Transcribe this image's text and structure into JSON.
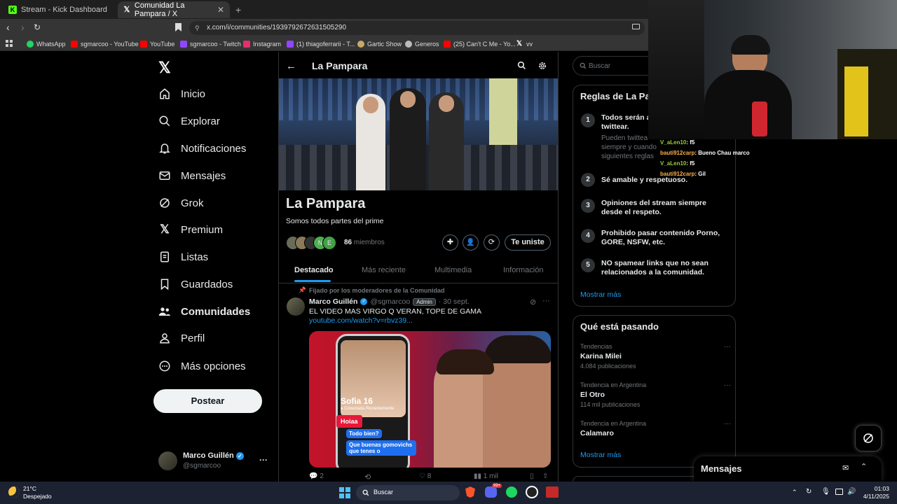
{
  "browser": {
    "tabs": [
      {
        "label": "Stream - Kick Dashboard",
        "icon": "kick-icon"
      },
      {
        "label": "Comunidad La Pampara / X",
        "icon": "x-logo-icon"
      }
    ],
    "url": "x.com/i/communities/1939792672631505290",
    "bookmarks": [
      "WhatsApp",
      "sgmarcoo - YouTube",
      "YouTube",
      "sgmarcoo - Twitch",
      "Instagram",
      "(1) thiagoferrarii - T...",
      "Gartic Show",
      "Generos",
      "(25) Can't C Me - Yo...",
      "vv"
    ]
  },
  "sidebar": {
    "items": [
      "Inicio",
      "Explorar",
      "Notificaciones",
      "Mensajes",
      "Grok",
      "Premium",
      "Listas",
      "Guardados",
      "Comunidades",
      "Perfil",
      "Más opciones"
    ],
    "post_label": "Postear",
    "user_name": "Marco Guillén",
    "user_handle": "@sgmarcoo"
  },
  "community": {
    "header_title": "La Pampara",
    "name": "La Pampara",
    "description": "Somos todos partes del prime",
    "member_count": "86",
    "members_label": "miembros",
    "member_initials": [
      "N",
      "E"
    ],
    "join_label": "Te uniste",
    "tabs": [
      "Destacado",
      "Más reciente",
      "Multimedia",
      "Información"
    ]
  },
  "post": {
    "pinned_label": "Fijado por los moderadores de la Comunidad",
    "author": "Marco Guillén",
    "handle": "@sgmarcoo",
    "badge": "Admin",
    "date": "· 30 sept.",
    "text": "EL VIDEO MAS VIRGO Q VERAN, TOPE DE GAMA",
    "link": "youtube.com/watch?v=rbvz39...",
    "thumb_name": "Sofia 16",
    "thumb_status": "● Conectada Recientemente",
    "thumb_tag": "Hoiaa",
    "thumb_msg1": "Todo bien?",
    "thumb_msg2": "Que buenas gomovichs que tenes o",
    "replies": "2",
    "likes": "8",
    "views": "1 mil"
  },
  "right": {
    "search_placeholder": "Buscar",
    "rules_title": "Reglas de La Pa",
    "rule1": "Todos serán a",
    "rule1b": "twittear.",
    "rule1_sub": "Pueden twittea",
    "rule1_sub2": "siempre y cuando",
    "rule1_sub3": "siguientes reglas",
    "rules": [
      {
        "num": "2",
        "text": "Sé amable y respetuoso."
      },
      {
        "num": "3",
        "text": "Opiniones del stream siempre desde el respeto."
      },
      {
        "num": "4",
        "text": "Prohibido pasar contenido Porno, GORE, NSFW, etc."
      },
      {
        "num": "5",
        "text": "NO spamear links que no sean relacionados a la comunidad."
      }
    ],
    "rules_more": "Mostrar más",
    "trends_title": "Qué está pasando",
    "trends": [
      {
        "context": "Tendencias",
        "name": "Karina Milei",
        "count": "4.084 publicaciones"
      },
      {
        "context": "Tendencia en Argentina",
        "name": "El Otro",
        "count": "114 mil publicaciones"
      },
      {
        "context": "Tendencia en Argentina",
        "name": "Calamaro",
        "count": ""
      }
    ],
    "trends_more": "Mostrar más",
    "messages_label": "Mensajes"
  },
  "chat": [
    {
      "user": "V_aLen10",
      "msg": ": f5",
      "color": "#9acd32"
    },
    {
      "user": "bauti912carp",
      "msg": ": Bueno Chau marco",
      "color": "#ffb347"
    },
    {
      "user": "V_aLen10",
      "msg": ": f5",
      "color": "#9acd32"
    },
    {
      "user": "bauti912carp",
      "msg": ": Gil",
      "color": "#ffb347"
    }
  ],
  "taskbar": {
    "temp": "21°C",
    "weather": "Despejado",
    "search": "Buscar",
    "time": "01:03",
    "date": "4/11/2025",
    "discord_badge": "99+"
  }
}
